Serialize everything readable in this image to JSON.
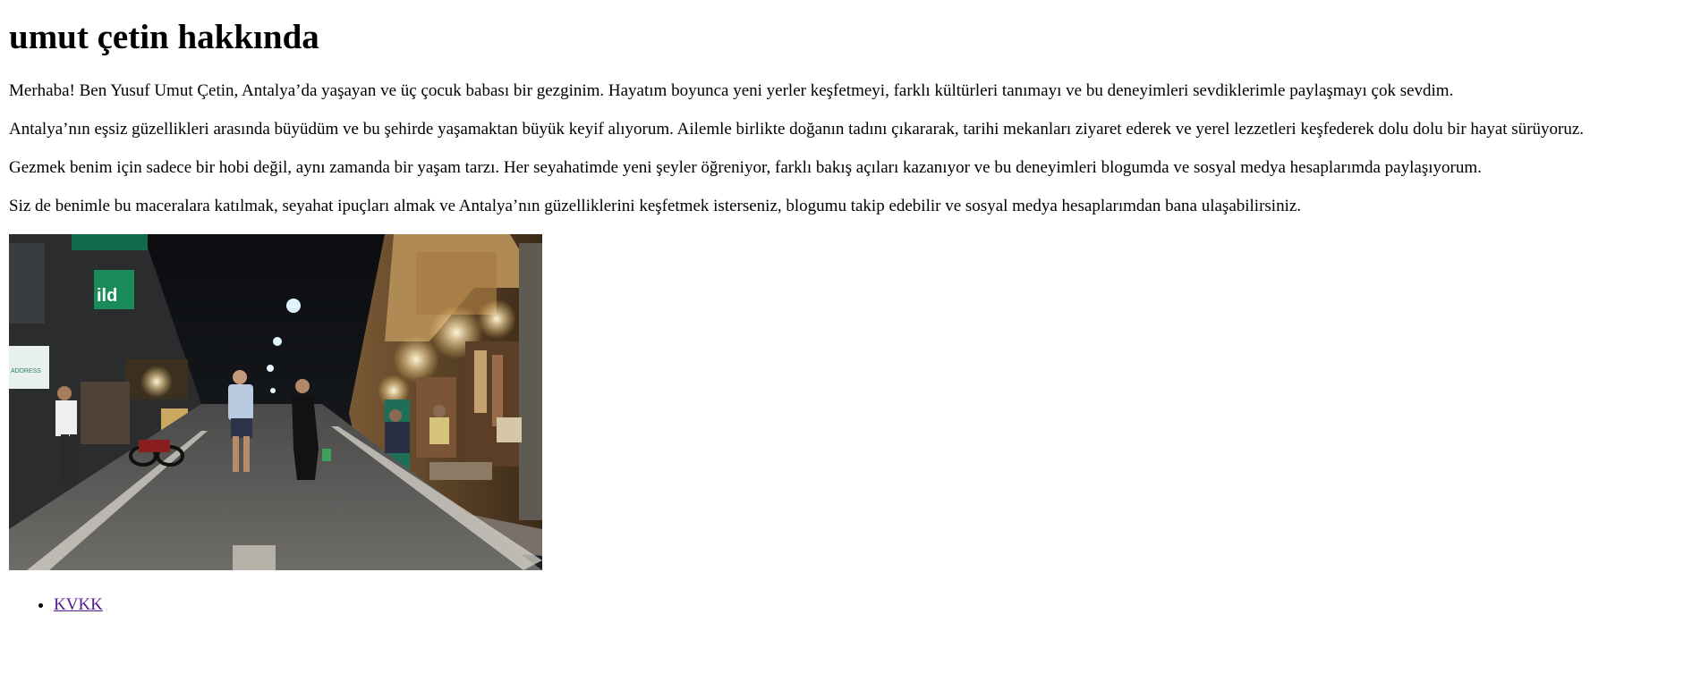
{
  "page": {
    "heading": "umut çetin hakkında",
    "paragraphs": [
      "Merhaba! Ben Yusuf Umut Çetin, Antalya’da yaşayan ve üç çocuk babası bir gezginim. Hayatım boyunca yeni yerler keşfetmeyi, farklı kültürleri tanımayı ve bu deneyimleri sevdiklerimle paylaşmayı çok sevdim.",
      "Antalya’nın eşsiz güzellikleri arasında büyüdüm ve bu şehirde yaşamaktan büyük keyif alıyorum. Ailemle birlikte doğanın tadını çıkararak, tarihi mekanları ziyaret ederek ve yerel lezzetleri keşfederek dolu dolu bir hayat sürüyoruz.",
      "Gezmek benim için sadece bir hobi değil, aynı zamanda bir yaşam tarzı. Her seyahatimde yeni şeyler öğreniyor, farklı bakış açıları kazanıyor ve bu deneyimleri blogumda ve sosyal medya hesaplarımda paylaşıyorum.",
      "Siz de benimle bu maceralara katılmak, seyahat ipuçları almak ve Antalya’nın güzelliklerini keşfetmek isterseniz, blogumu takip edebilir ve sosyal medya hesaplarımdan bana ulaşabilirsiniz."
    ],
    "photo": {
      "subject": "night-street-market-photo",
      "sign_text_1": "ild",
      "sign_text_2": "ADDRESS"
    },
    "links": [
      {
        "label": "KVKK"
      }
    ]
  },
  "colors": {
    "text": "#000000",
    "visited_link": "#551a8b",
    "background": "#ffffff"
  }
}
